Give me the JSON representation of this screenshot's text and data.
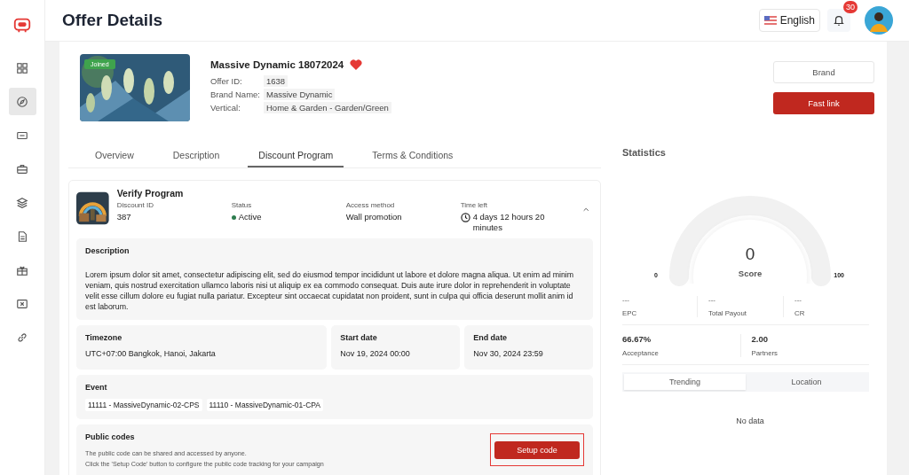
{
  "page_title": "Offer Details",
  "sidebar": {
    "items": [
      {
        "kind": "grid",
        "selected": false
      },
      {
        "kind": "compass",
        "selected": true
      },
      {
        "kind": "ticket",
        "selected": false
      },
      {
        "kind": "briefcase",
        "selected": false
      },
      {
        "kind": "layers",
        "selected": false
      },
      {
        "kind": "document",
        "selected": false
      },
      {
        "kind": "gift",
        "selected": false
      },
      {
        "kind": "coupon",
        "selected": false
      },
      {
        "kind": "link",
        "selected": false
      }
    ]
  },
  "header": {
    "language": "English",
    "notifications": "30"
  },
  "offer": {
    "badge": "Joined",
    "name": "Massive Dynamic 18072024",
    "favorite": true,
    "fields": [
      {
        "label": "Offer ID:",
        "value": "1638"
      },
      {
        "label": "Brand Name:",
        "value": "Massive Dynamic"
      },
      {
        "label": "Vertical:",
        "value": "Home & Garden - Garden/Green"
      }
    ],
    "buttons": [
      {
        "label": "Brand",
        "kind": "outline"
      },
      {
        "label": "Fast link",
        "kind": "primary"
      }
    ]
  },
  "tabs": [
    {
      "label": "Overview",
      "selected": false
    },
    {
      "label": "Description",
      "selected": false
    },
    {
      "label": "Discount Program",
      "selected": true
    },
    {
      "label": "Terms & Conditions",
      "selected": false
    }
  ],
  "program": {
    "title": "Verify Program",
    "expanded": true,
    "info": [
      {
        "label": "Discount ID",
        "value": "387",
        "kind": "plain"
      },
      {
        "label": "Status",
        "value": "Active",
        "kind": "status",
        "color": "#2e7d4f"
      },
      {
        "label": "Access method",
        "value": "Wall promotion",
        "kind": "plain"
      },
      {
        "label": "Time left",
        "value": "4 days 12 hours 20 minutes",
        "kind": "time"
      }
    ],
    "description_title": "Description",
    "description": "Lorem ipsum dolor sit amet, consectetur adipiscing elit, sed do eiusmod tempor incididunt ut labore et dolore magna aliqua. Ut enim ad minim veniam, quis nostrud exercitation ullamco laboris nisi ut aliquip ex ea commodo consequat. Duis aute irure dolor in reprehenderit in voluptate velit esse cillum dolore eu fugiat nulla pariatur. Excepteur sint occaecat cupidatat non proident, sunt in culpa qui officia deserunt mollit anim id est laborum.",
    "dates": [
      {
        "label": "Timezone",
        "value": "UTC+07:00 Bangkok, Hanoi, Jakarta"
      },
      {
        "label": "Start date",
        "value": "Nov 19, 2024 00:00"
      },
      {
        "label": "End date",
        "value": "Nov 30, 2024 23:59"
      }
    ],
    "event_title": "Event",
    "events": [
      "11111 - MassiveDynamic-02-CPS",
      "11110 - MassiveDynamic-01-CPA"
    ],
    "public_codes": {
      "title": "Public codes",
      "lines": [
        "The public code can be shared and accessed by anyone.",
        "Click the 'Setup Code' button to configure the public code tracking for your campaign"
      ],
      "button": "Setup code"
    }
  },
  "statistics": {
    "title": "Statistics",
    "gauge": {
      "value": "0",
      "label": "Score",
      "min": "0",
      "max": "100"
    },
    "metrics": [
      {
        "value": "---",
        "label": "EPC"
      },
      {
        "value": "---",
        "label": "Total Payout"
      },
      {
        "value": "---",
        "label": "CR"
      }
    ],
    "metrics2": [
      {
        "value": "66.67%",
        "label": "Acceptance"
      },
      {
        "value": "2.00",
        "label": "Partners"
      }
    ],
    "tabs": [
      {
        "label": "Trending",
        "selected": true
      },
      {
        "label": "Location",
        "selected": false
      }
    ],
    "empty": "No data"
  }
}
